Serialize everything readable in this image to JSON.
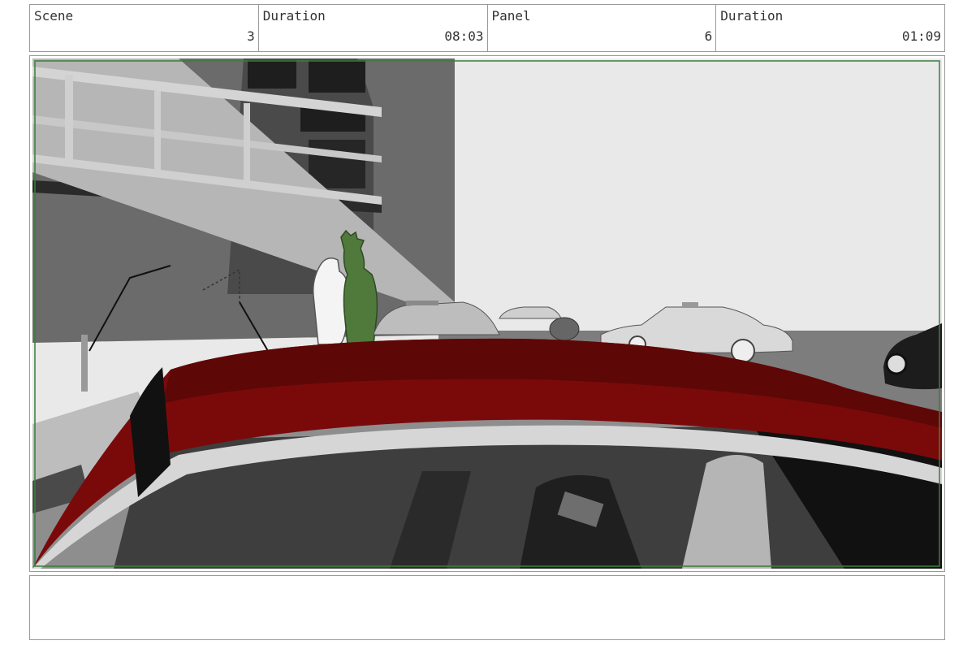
{
  "header": {
    "scene_label": "Scene",
    "scene_value": "3",
    "scene_duration_label": "Duration",
    "scene_duration_value": "08:03",
    "panel_label": "Panel",
    "panel_value": "6",
    "panel_duration_label": "Duration",
    "panel_duration_value": "01:09"
  },
  "notes": {
    "text": ""
  },
  "colors": {
    "safe_frame": "#3c7d3c",
    "car_roof": "#7a0a0a",
    "character_highlight": "#4f7a3c",
    "sky": "#e9e9e9"
  }
}
